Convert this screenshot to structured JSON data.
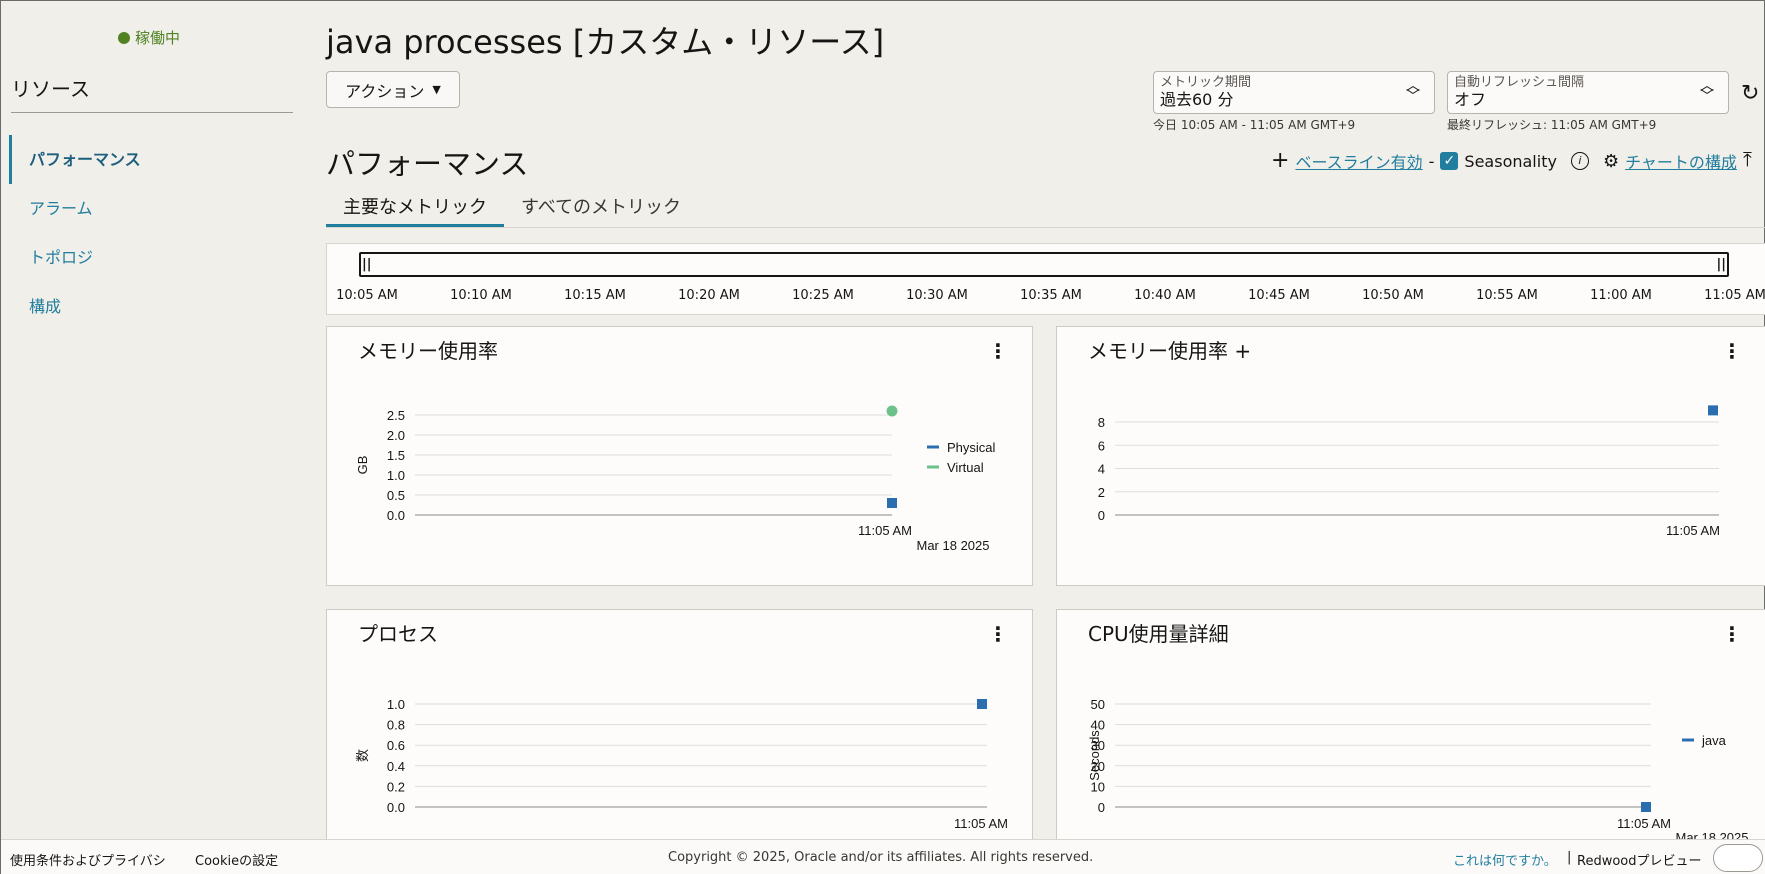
{
  "sidebar": {
    "status": "稼働中",
    "title": "リソース",
    "items": [
      {
        "label": "パフォーマンス"
      },
      {
        "label": "アラーム"
      },
      {
        "label": "トポロジ"
      },
      {
        "label": "構成"
      }
    ]
  },
  "header": {
    "title": "java processes [カスタム・リソース]",
    "action_label": "アクション",
    "metric_period": {
      "label": "メトリック期間",
      "value": "過去60 分",
      "note": "今日 10:05 AM - 11:05 AM GMT+9"
    },
    "auto_refresh": {
      "label": "自動リフレッシュ間隔",
      "value": "オフ",
      "note": "最終リフレッシュ: 11:05 AM GMT+9"
    }
  },
  "section": {
    "title": "パフォーマンス",
    "baseline_link": "ベースライン有効",
    "separator": "-",
    "seasonality": "Seasonality",
    "configure_link": "チャートの構成"
  },
  "tabs": [
    {
      "label": "主要なメトリック"
    },
    {
      "label": "すべてのメトリック"
    }
  ],
  "timeline": {
    "labels": [
      "10:05 AM",
      "10:10 AM",
      "10:15 AM",
      "10:20 AM",
      "10:25 AM",
      "10:30 AM",
      "10:35 AM",
      "10:40 AM",
      "10:45 AM",
      "10:50 AM",
      "10:55 AM",
      "11:00 AM",
      "11:05 AM"
    ]
  },
  "colors": {
    "accent": "#227e9e",
    "physical": "#2a6eb0",
    "virtual": "#6dc28b",
    "status": "#508223"
  },
  "chart_data": [
    {
      "type": "scatter",
      "title": "メモリー使用率",
      "ylabel": "GB",
      "ylim": [
        0,
        2.5
      ],
      "yticks": [
        "2.5",
        "2.0",
        "1.5",
        "1.0",
        "0.5",
        "0.0"
      ],
      "x_labels": [
        "11:05 AM",
        "Mar 18 2025"
      ],
      "series": [
        {
          "name": "Physical",
          "color": "#2a6eb0",
          "marker": "square",
          "values": [
            0.3
          ]
        },
        {
          "name": "Virtual",
          "color": "#6dc28b",
          "marker": "circle",
          "values": [
            2.6
          ]
        }
      ],
      "legend": "right"
    },
    {
      "type": "scatter",
      "title": "メモリー使用率 +",
      "ylabel": "",
      "ylim": [
        0,
        8
      ],
      "yticks": [
        "8",
        "6",
        "4",
        "2",
        "0"
      ],
      "x_labels": [
        "11:05 AM"
      ],
      "series": [
        {
          "color": "#2a6eb0",
          "marker": "square",
          "values": [
            9
          ]
        }
      ]
    },
    {
      "type": "scatter",
      "title": "プロセス",
      "ylabel": "数",
      "ylim": [
        0,
        1.0
      ],
      "yticks": [
        "1.0",
        "0.8",
        "0.6",
        "0.4",
        "0.2",
        "0.0"
      ],
      "x_labels": [
        "11:05 AM"
      ],
      "series": [
        {
          "color": "#2a6eb0",
          "marker": "square",
          "values": [
            1.0
          ]
        }
      ]
    },
    {
      "type": "scatter",
      "title": "CPU使用量詳細",
      "ylabel": "Seconds",
      "ylim": [
        0,
        50
      ],
      "yticks": [
        "50",
        "40",
        "30",
        "20",
        "10",
        "0"
      ],
      "x_labels": [
        "11:05 AM",
        "Mar 18 2025"
      ],
      "series": [
        {
          "name": "java",
          "color": "#2a6eb0",
          "marker": "square",
          "values": [
            0
          ]
        }
      ],
      "legend": "right"
    }
  ],
  "footer": {
    "terms": "使用条件およびプライバシ",
    "cookie": "Cookieの設定",
    "copyright": "Copyright © 2025, Oracle and/or its affiliates. All rights reserved.",
    "what_is": "これは何ですか。",
    "divider": "|",
    "redwood": "Redwoodプレビュー"
  }
}
